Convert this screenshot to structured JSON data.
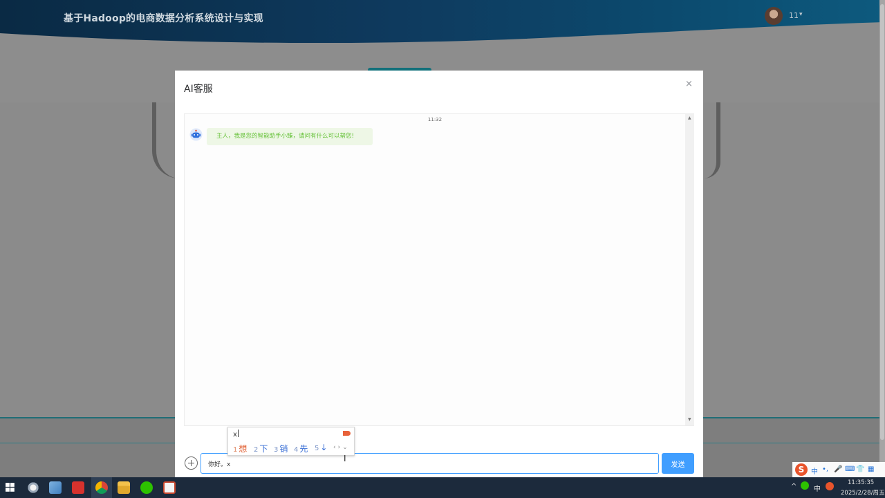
{
  "app": {
    "title": "基于Hadoop的电商数据分析系统设计与实现",
    "user_name": "11",
    "user_caret": "▾"
  },
  "dialog": {
    "title": "AI客服",
    "close_glyph": "×",
    "chat": {
      "timestamp": "11:32",
      "bot_message": "主人，我是您的智能助手小臻，请问有什么可以帮您!"
    },
    "input": {
      "value": "你好。x"
    },
    "send_label": "发送"
  },
  "ime_popup": {
    "composition": "x",
    "candidates": [
      {
        "num": "1",
        "text": "想"
      },
      {
        "num": "2",
        "text": "下"
      },
      {
        "num": "3",
        "text": "销"
      },
      {
        "num": "4",
        "text": "先"
      },
      {
        "num": "5",
        "text": "↓"
      }
    ],
    "nav": "‹›⌄"
  },
  "ime_toolbar": {
    "logo": "S",
    "mode": "中",
    "punct": "•,",
    "items": [
      "🎤",
      "⌨",
      "👕",
      "▦"
    ]
  },
  "taskbar": {
    "tray_mode": "中",
    "clock_time": "11:35:35",
    "clock_date": "2025/2/28/周五",
    "tray_caret": "^"
  },
  "colors": {
    "primary": "#409eff",
    "bot_text": "#67c23a",
    "bot_bubble": "#eef7e6",
    "header_dark": "#0a2a44",
    "ime_candidate": "#3a6fd6",
    "ime_active": "#e05a2b"
  }
}
